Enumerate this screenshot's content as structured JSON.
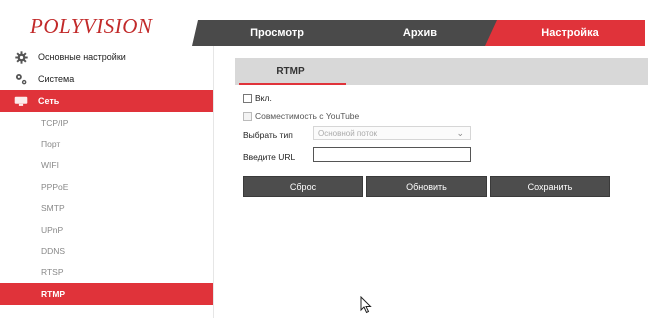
{
  "brand": {
    "logo_text": "POLYVISION"
  },
  "top_tabs": [
    {
      "label": "Просмотр"
    },
    {
      "label": "Архив"
    },
    {
      "label": "Настройка",
      "active": true
    }
  ],
  "sidebar": {
    "items": [
      {
        "label": "Основные настройки",
        "icon": "gear-icon"
      },
      {
        "label": "Система",
        "icon": "gears-icon"
      },
      {
        "label": "Сеть",
        "icon": "network-icon",
        "active": true
      }
    ],
    "subitems": [
      {
        "label": "TCP/IP"
      },
      {
        "label": "Порт"
      },
      {
        "label": "WIFI"
      },
      {
        "label": "PPPoE"
      },
      {
        "label": "SMTP"
      },
      {
        "label": "UPnP"
      },
      {
        "label": "DDNS"
      },
      {
        "label": "RTSP"
      },
      {
        "label": "RTMP",
        "active": true
      }
    ]
  },
  "content": {
    "tab_label": "RTMP",
    "enable_label": "Вкл.",
    "youtube_label": "Совместимость с YouTube",
    "type_label": "Выбрать тип",
    "type_value": "Основной поток",
    "url_label": "Введите URL",
    "url_value": ""
  },
  "buttons": {
    "reset": "Сброс",
    "refresh": "Обновить",
    "save": "Сохранить"
  },
  "colors": {
    "accent": "#e0333a",
    "tab_dark": "#4a4a4a",
    "button": "#4d4d4d"
  }
}
